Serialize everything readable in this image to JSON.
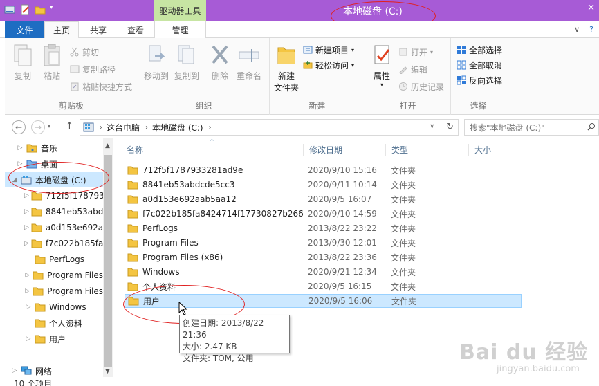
{
  "window": {
    "title": "本地磁盘 (C:)",
    "context_tab_title": "驱动器工具",
    "controls": {
      "minimize": "—",
      "close": "✕"
    }
  },
  "ribbon_tabs": {
    "file": "文件",
    "home": "主页",
    "share": "共享",
    "view": "查看",
    "manage": "管理"
  },
  "ribbon": {
    "clipboard": {
      "label": "剪贴板",
      "copy": "复制",
      "paste": "粘贴",
      "cut": "剪切",
      "copy_path": "复制路径",
      "paste_shortcut": "粘贴快捷方式"
    },
    "organize": {
      "label": "组织",
      "move_to": "移动到",
      "copy_to": "复制到",
      "delete": "删除",
      "rename": "重命名"
    },
    "new": {
      "label": "新建",
      "new_folder_line1": "新建",
      "new_folder_line2": "文件夹",
      "new_item": "新建项目",
      "easy_access": "轻松访问"
    },
    "open": {
      "label": "打开",
      "properties": "属性",
      "open": "打开",
      "edit": "编辑",
      "history": "历史记录"
    },
    "select": {
      "label": "选择",
      "select_all": "全部选择",
      "select_none": "全部取消",
      "invert": "反向选择"
    }
  },
  "address": {
    "crumbs": [
      "这台电脑",
      "本地磁盘 (C:)"
    ],
    "search_placeholder": "搜索\"本地磁盘 (C:)\""
  },
  "nav_pane": {
    "items": [
      {
        "label": "音乐",
        "level": 1,
        "expander": true
      },
      {
        "label": "桌面",
        "level": 1,
        "expander": true
      },
      {
        "label": "本地磁盘 (C:)",
        "level": 0,
        "expander": true,
        "selected": true
      },
      {
        "label": "712f5f178793",
        "level": 2,
        "expander": true
      },
      {
        "label": "8841eb53abd",
        "level": 2,
        "expander": true
      },
      {
        "label": "a0d153e692a",
        "level": 2,
        "expander": true
      },
      {
        "label": "f7c022b185fa",
        "level": 2,
        "expander": true
      },
      {
        "label": "PerfLogs",
        "level": 2,
        "expander": false
      },
      {
        "label": "Program Files",
        "level": 2,
        "expander": true
      },
      {
        "label": "Program Files",
        "level": 2,
        "expander": true
      },
      {
        "label": "Windows",
        "level": 2,
        "expander": true
      },
      {
        "label": "个人资料",
        "level": 2,
        "expander": false
      },
      {
        "label": "用户",
        "level": 2,
        "expander": true
      },
      {
        "label": "网络",
        "level": 0,
        "expander": true
      }
    ]
  },
  "columns": {
    "name": "名称",
    "date": "修改日期",
    "type": "类型",
    "size": "大小"
  },
  "files": [
    {
      "name": "712f5f1787933281ad9e",
      "date": "2020/9/10 15:16",
      "type": "文件夹"
    },
    {
      "name": "8841eb53abdcde5cc3",
      "date": "2020/9/11 10:14",
      "type": "文件夹"
    },
    {
      "name": "a0d153e692aab5aa12",
      "date": "2020/9/5 16:07",
      "type": "文件夹"
    },
    {
      "name": "f7c022b185fa8424714f17730827b266",
      "date": "2020/9/10 14:59",
      "type": "文件夹"
    },
    {
      "name": "PerfLogs",
      "date": "2013/8/22 23:22",
      "type": "文件夹"
    },
    {
      "name": "Program Files",
      "date": "2013/9/30 12:01",
      "type": "文件夹"
    },
    {
      "name": "Program Files (x86)",
      "date": "2013/8/22 23:36",
      "type": "文件夹"
    },
    {
      "name": "Windows",
      "date": "2020/9/21 12:34",
      "type": "文件夹"
    },
    {
      "name": "个人资料",
      "date": "2020/9/5 16:15",
      "type": "文件夹"
    },
    {
      "name": "用户",
      "date": "2020/9/5 16:06",
      "type": "文件夹",
      "selected": true
    }
  ],
  "tooltip": {
    "created": "创建日期: 2013/8/22 21:36",
    "size": "大小: 2.47 KB",
    "contents": "文件夹: TOM, 公用"
  },
  "status": {
    "count": "10 个项目"
  },
  "watermark": {
    "main": "Bai du 经验",
    "sub": "jingyan.baidu.com"
  },
  "colors": {
    "titlebar": "#a75bd6",
    "file_tab": "#1e6dc2",
    "context_tab": "#c7e5a3",
    "selection": "#cce8ff",
    "folder": "#e8b430"
  }
}
